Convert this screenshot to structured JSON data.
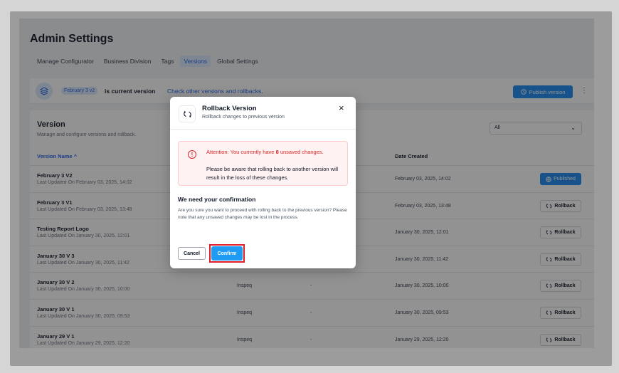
{
  "header": {
    "title": "Admin Settings",
    "tabs": [
      {
        "label": "Manage Configurator",
        "active": false
      },
      {
        "label": "Business Division",
        "active": false
      },
      {
        "label": "Tags",
        "active": false
      },
      {
        "label": "Versions",
        "active": true
      },
      {
        "label": "Global Settings",
        "active": false
      }
    ]
  },
  "banner": {
    "badge": "February 3 v2",
    "current_text": "is current version",
    "link_text": "Check other versions and rollbacks.",
    "publish_label": "Publish version",
    "more_icon": "⋮"
  },
  "version_card": {
    "title": "Version",
    "subtitle": "Manage and configure versions and rollback.",
    "filter_value": "All",
    "col_name": "Version Name ^",
    "col_date": "Date Created",
    "rows": [
      {
        "name": "February 3 V2",
        "updated": "Last Updated On February 03, 2025, 14:02",
        "org": "",
        "dash": "",
        "date": "February 03, 2025, 14:02",
        "action": "Published",
        "published": true
      },
      {
        "name": "February 3 V1",
        "updated": "Last Updated On February 03, 2025, 13:48",
        "org": "",
        "dash": "",
        "date": "February 03, 2025, 13:48",
        "action": "Rollback",
        "published": false
      },
      {
        "name": "Testing Report Logo",
        "updated": "Last Updated On January 30, 2025, 12:01",
        "org": "",
        "dash": "",
        "date": "January 30, 2025, 12:01",
        "action": "Rollback",
        "published": false
      },
      {
        "name": "January 30 V 3",
        "updated": "Last Updated On January 30, 2025, 11:42",
        "org": "",
        "dash": "",
        "date": "January 30, 2025, 11:42",
        "action": "Rollback",
        "published": false
      },
      {
        "name": "January 30 V 2",
        "updated": "Last Updated On January 30, 2025, 10:00",
        "org": "Inspeq",
        "dash": "-",
        "date": "January 30, 2025, 10:00",
        "action": "Rollback",
        "published": false
      },
      {
        "name": "January 30 V 1",
        "updated": "Last Updated On January 30, 2025, 09:53",
        "org": "Inspeq",
        "dash": "-",
        "date": "January 30, 2025, 09:53",
        "action": "Rollback",
        "published": false
      },
      {
        "name": "January 29 V 1",
        "updated": "Last Updated On January 29, 2025, 12:20",
        "org": "Inspeq",
        "dash": "-",
        "date": "January 29, 2025, 12:20",
        "action": "Rollback",
        "published": false
      }
    ]
  },
  "modal": {
    "title": "Rollback Version",
    "subtitle": "Rollback changes to previous version",
    "close": "×",
    "alert_prefix": "Attention: You currently have ",
    "alert_count": "8",
    "alert_suffix": " unsaved changes.",
    "alert_body": "Please be aware that rolling back to another version will result in the loss of these changes.",
    "confirm_heading": "We need your confirmation",
    "confirm_text": "Are you sure you want to proceed with rolling back to the previous version? Please note that any unsaved changes may be lost in the process.",
    "cancel_label": "Cancel",
    "confirm_label": "Confirm"
  },
  "colors": {
    "accent": "#1d8bf1",
    "danger": "#dc2626",
    "highlight": "#e11d2a"
  }
}
